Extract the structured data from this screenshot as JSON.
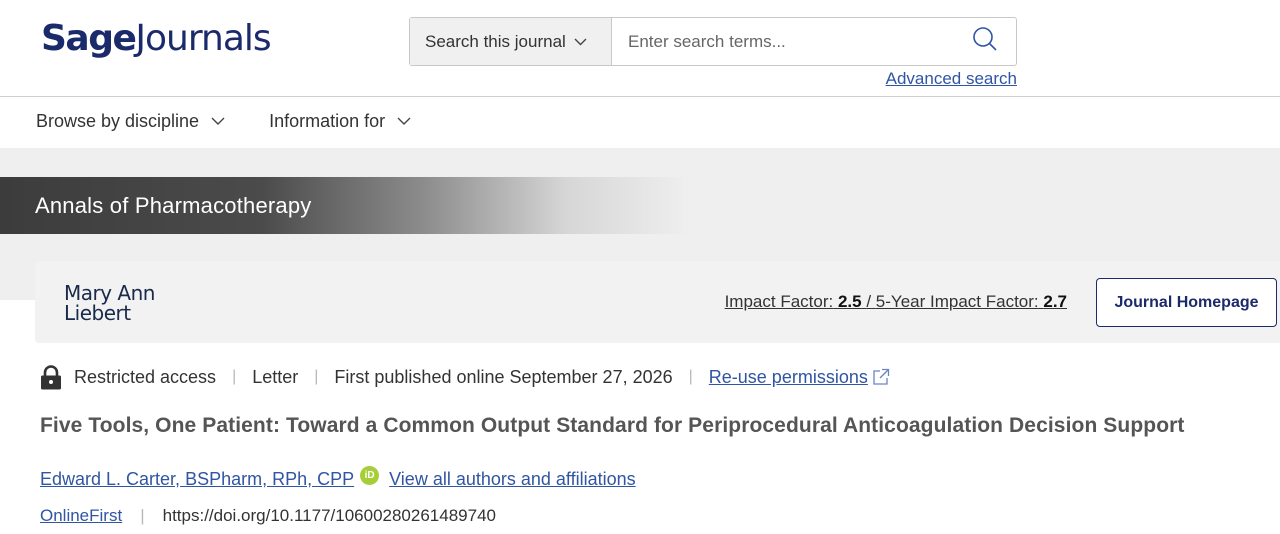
{
  "header": {
    "logo_brand": "Sage",
    "logo_product": "Journals",
    "search": {
      "scope_label": "Search this journal",
      "placeholder": "Enter search terms...",
      "advanced_label": "Advanced search"
    }
  },
  "nav": {
    "items": [
      {
        "label": "Browse by discipline"
      },
      {
        "label": "Information for"
      }
    ]
  },
  "journal": {
    "title": "Annals of Pharmacotherapy",
    "publisher_line1": "Mary Ann",
    "publisher_line2": "Liebert",
    "impact_label": "Impact Factor:",
    "impact_value": "2.5",
    "impact_sep": "/",
    "five_year_label": "5-Year Impact Factor:",
    "five_year_value": "2.7",
    "homepage_label": "Journal Homepage"
  },
  "article": {
    "access": "Restricted access",
    "type": "Letter",
    "published": "First published online September 27, 2026",
    "reuse_label": "Re-use permissions",
    "title": "Five Tools, One Patient: Toward a Common Output Standard for Periprocedural Anticoagulation Decision Support",
    "author": "Edward L. Carter, BSPharm, RPh, CPP",
    "orcid_label": "iD",
    "view_all_label": "View all authors and affiliations",
    "section": "OnlineFirst",
    "doi": "https://doi.org/10.1177/10600280261489740"
  },
  "colors": {
    "brand": "#1b2a6b",
    "link": "#2f55a4",
    "orcid": "#a6ce39"
  }
}
